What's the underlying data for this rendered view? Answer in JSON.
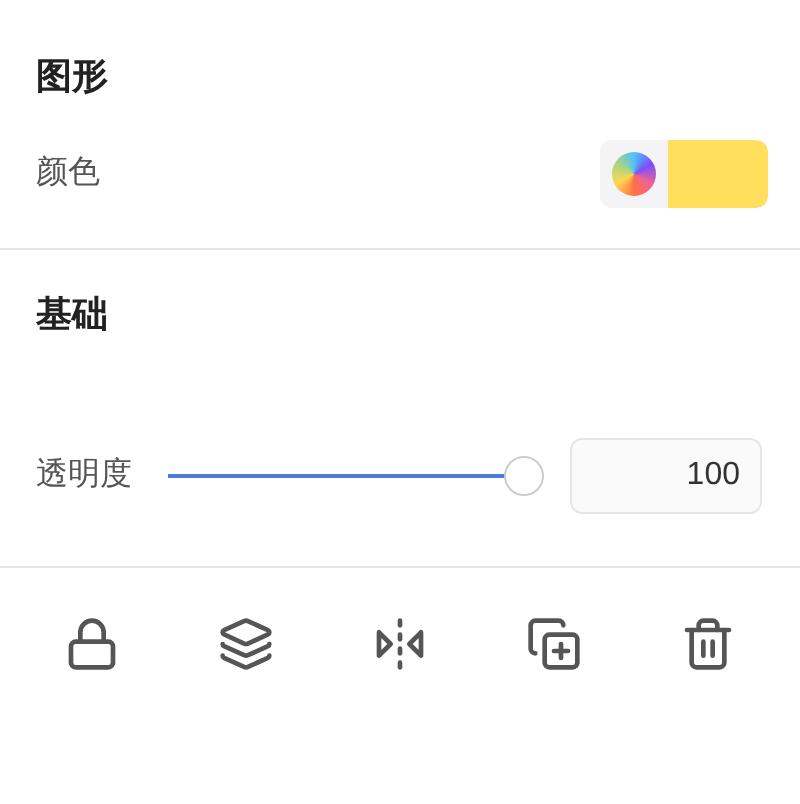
{
  "shape": {
    "title": "图形",
    "color_label": "颜色",
    "color": "#ffdf5c"
  },
  "base": {
    "title": "基础",
    "opacity_label": "透明度",
    "level": 1,
    "reading": "100"
  },
  "toolbar": [
    {
      "kind": "lock"
    },
    {
      "kind": "layers"
    },
    {
      "kind": "flip"
    },
    {
      "kind": "duplicate"
    },
    {
      "kind": "delete"
    }
  ]
}
